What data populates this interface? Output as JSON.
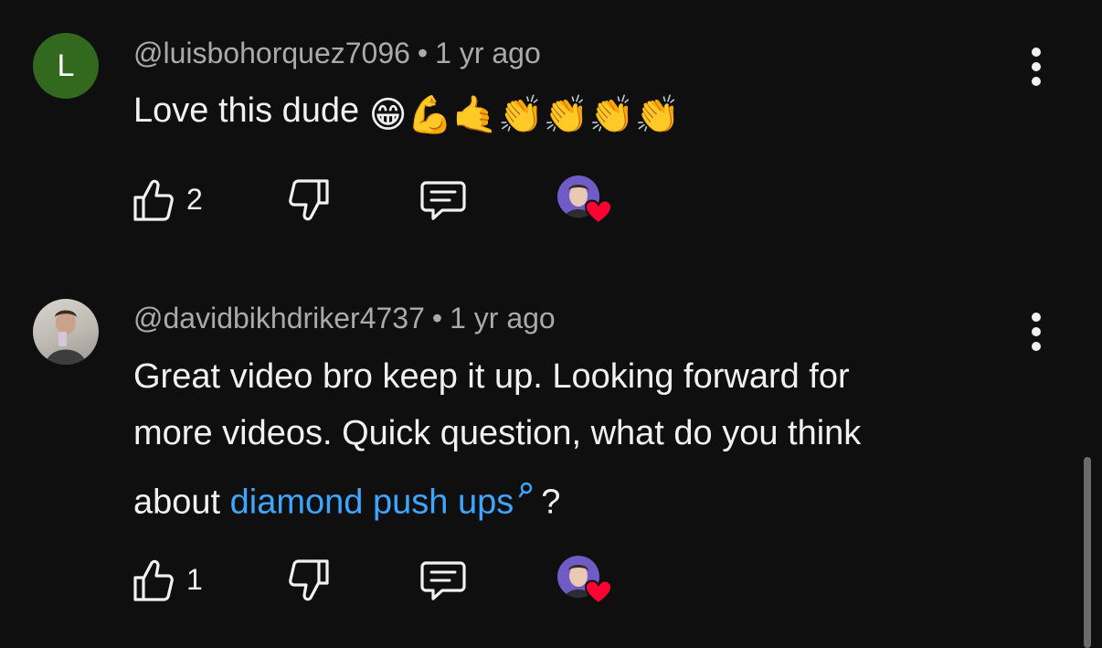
{
  "comments": [
    {
      "avatar_letter": "L",
      "handle": "@luisbohorquez7096",
      "separator": "•",
      "time": "1 yr ago",
      "text": "Love this dude",
      "emojis": [
        "😁",
        "💪",
        "🤙",
        "👏",
        "👏",
        "👏",
        "👏"
      ],
      "like_count": "2",
      "creator_hearted": true
    },
    {
      "handle": "@davidbikhdriker4737",
      "separator": "•",
      "time": "1 yr ago",
      "text_lines": [
        "Great video bro keep it up. Looking forward for",
        "more videos. Quick question, what do you think"
      ],
      "text_prefix": "about ",
      "link_text": "diamond push ups",
      "text_suffix": "?",
      "like_count": "1",
      "creator_hearted": true
    }
  ],
  "colors": {
    "background": "#0f0f0f",
    "link": "#3ea6ff",
    "secondary_text": "#aaaaaa",
    "heart": "#ff0033",
    "avatar_letter_bg": "#33691e"
  }
}
